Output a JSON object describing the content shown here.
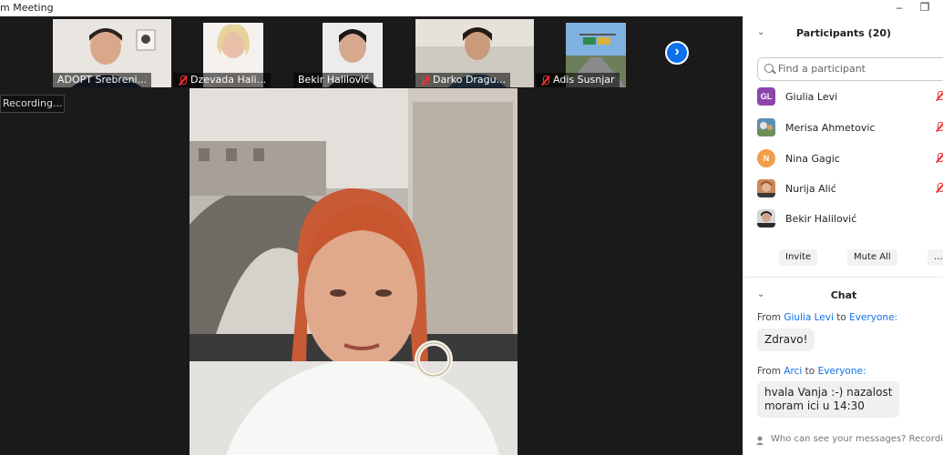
{
  "window": {
    "title": "m Meeting"
  },
  "thumbnails": [
    {
      "name": "ADOPT Srebreni...",
      "muted": false
    },
    {
      "name": "Dzevada Hali...",
      "muted": true
    },
    {
      "name": "Bekir Halilović",
      "muted": false
    },
    {
      "name": "Darko Dragu...",
      "muted": true
    },
    {
      "name": "Adis Susnjar",
      "muted": true
    }
  ],
  "recording": {
    "label": "Recording..."
  },
  "participants": {
    "title": "Participants",
    "count": "(20)",
    "search_placeholder": "Find a participant",
    "list": [
      {
        "name": "Giulia Levi",
        "initials": "GL",
        "avatar_color": "#8e44ad",
        "muted": true
      },
      {
        "name": "Merisa Ahmetovic",
        "initials": "",
        "avatar_color": "#5a8fb4",
        "muted": true
      },
      {
        "name": "Nina Gagic",
        "initials": "N",
        "avatar_color": "#f39c4a",
        "muted": true
      },
      {
        "name": "Nurija Alić",
        "initials": "",
        "avatar_color": "#a0522d",
        "muted": true
      },
      {
        "name": "Bekir Halilović",
        "initials": "",
        "avatar_color": "#4a4a4a",
        "muted": false
      }
    ],
    "invite_label": "Invite",
    "mute_all_label": "Mute All",
    "more_label": "..."
  },
  "chat": {
    "title": "Chat",
    "messages": [
      {
        "from_prefix": "From",
        "sender": "Giulia Levi",
        "to_word": "to",
        "recipient": "Everyone:",
        "lines": [
          "Zdravo!"
        ]
      },
      {
        "from_prefix": "From",
        "sender": "Arci",
        "to_word": "to",
        "recipient": "Everyone:",
        "lines": [
          "hvala Vanja :-) nazalost",
          "moram ici u 14:30"
        ]
      }
    ],
    "footer_hint": "Who can see your messages? Recording C"
  }
}
